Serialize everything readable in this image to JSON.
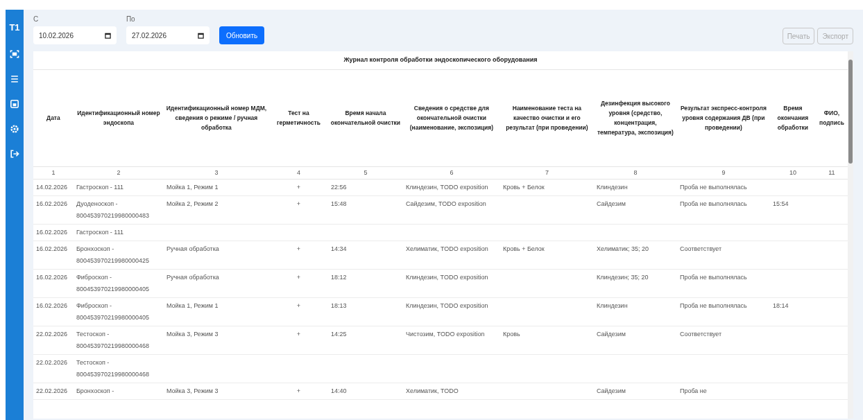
{
  "sidebar": {
    "logo": "T1"
  },
  "filters": [
    {
      "label": "С",
      "value": "10.02.2026"
    },
    {
      "label": "По",
      "value": "27.02.2026"
    }
  ],
  "refresh_button": "Обновить",
  "actions": [
    {
      "label": "Печать",
      "disabled": true
    },
    {
      "label": "Экспорт",
      "disabled": true
    }
  ],
  "table": {
    "title": "Журнал контроля обработки эндоскопического оборудования",
    "columns": [
      "Дата",
      "Идентификационный номер эндоскопа",
      "Идентификационный номер МДМ, сведения о режиме / ручная обработка",
      "Тест на герметичность",
      "Время начала окончательной очистки",
      "Сведения о средстве для окончательной очистки (наименование, экспозиция)",
      "Наименование теста на качество очистки и его результат (при проведении)",
      "Дезинфекция высокого уровня (средство, концентрация, температура, экспозиция)",
      "Результат экспресс-контроля уровня содержания ДВ (при проведении)",
      "Время окончания обработки",
      "ФИО, подпись"
    ],
    "column_numbers": [
      "1",
      "2",
      "3",
      "4",
      "5",
      "6",
      "7",
      "8",
      "9",
      "10",
      "11"
    ],
    "rows": [
      {
        "date": "14.02.2026",
        "endoscope": "Гастроскоп - 111",
        "mdm": "Мойка 1, Режим 1",
        "leak_test": "+",
        "start_time": "22:56",
        "final_cleaning": "Клиндезин, TODO exposition",
        "quality_test": "Кровь + Белок",
        "disinfection": "Клиндезин",
        "express_result": "Проба не выполнялась"
      },
      {
        "date": "16.02.2026",
        "endoscope": "Дуоденоскоп - 800453970219980000483",
        "mdm": "Мойка 2, Режим 2",
        "leak_test": "+",
        "start_time": "15:48",
        "final_cleaning": "Сайдезим, TODO exposition",
        "disinfection": "Сайдезим",
        "express_result": "Проба не выполнялась",
        "end_time": "15:54"
      },
      {
        "date": "16.02.2026",
        "endoscope": "Гастроскоп - 111"
      },
      {
        "date": "16.02.2026",
        "endoscope": "Бронхоскоп - 800453970219980000425",
        "mdm": "Ручная обработка",
        "leak_test": "+",
        "start_time": "14:34",
        "final_cleaning": "Хелиматик, TODO exposition",
        "quality_test": "Кровь + Белок",
        "disinfection": "Хелиматик; 35; 20",
        "express_result": "Соответствует"
      },
      {
        "date": "16.02.2026",
        "endoscope": "Фиброскоп - 800453970219980000405",
        "mdm": "Ручная обработка",
        "leak_test": "+",
        "start_time": "18:12",
        "final_cleaning": "Клиндезин, TODO exposition",
        "disinfection": "Клиндезин; 35; 20",
        "express_result": "Проба не выполнялась"
      },
      {
        "date": "16.02.2026",
        "endoscope": "Фиброскоп - 800453970219980000405",
        "mdm": "Мойка 1, Режим 1",
        "leak_test": "+",
        "start_time": "18:13",
        "final_cleaning": "Клиндезин, TODO exposition",
        "disinfection": "Клиндезин",
        "express_result": "Проба не выполнялась",
        "end_time": "18:14"
      },
      {
        "date": "22.02.2026",
        "endoscope": "Тестоскоп - 800453970219980000468",
        "mdm": "Мойка 3, Режим 3",
        "leak_test": "+",
        "start_time": "14:25",
        "final_cleaning": "Чистозим, TODO exposition",
        "quality_test": "Кровь",
        "disinfection": "Сайдезим",
        "express_result": "Соответствует"
      },
      {
        "date": "22.02.2026",
        "endoscope": "Тестоскоп - 800453970219980000468"
      },
      {
        "date": "22.02.2026",
        "endoscope": "Бронхоскоп -",
        "mdm": "Мойка 3, Режим 3",
        "leak_test": "+",
        "start_time": "14:40",
        "final_cleaning": "Хелиматик, TODO",
        "disinfection": "Сайдезим",
        "express_result": "Проба не"
      }
    ]
  }
}
